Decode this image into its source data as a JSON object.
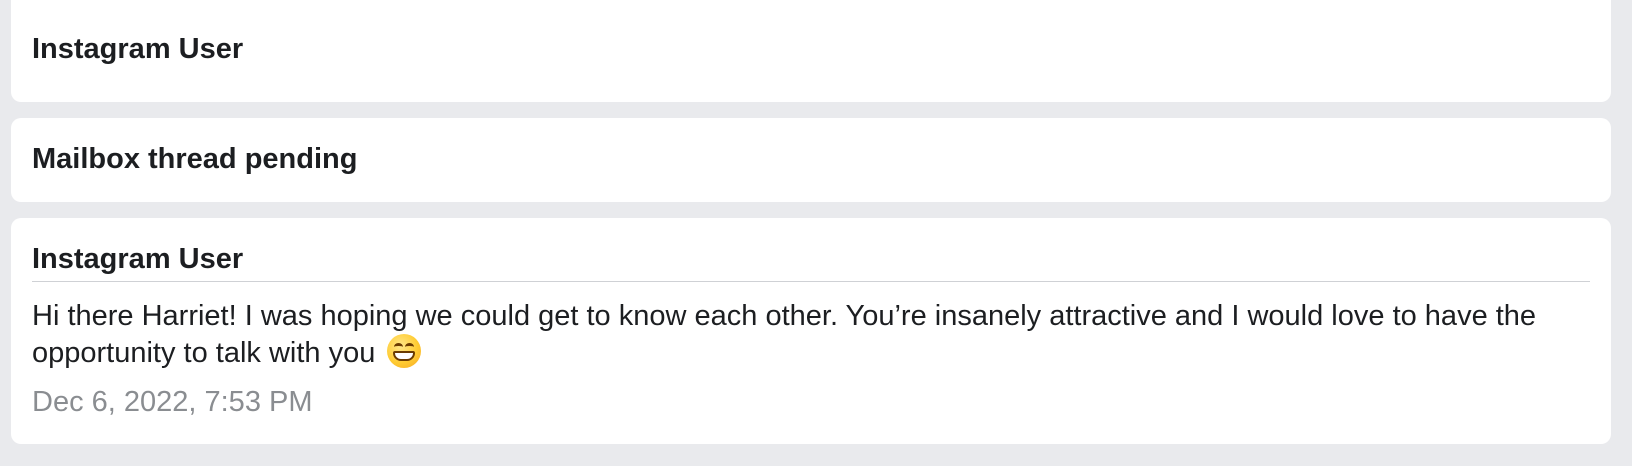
{
  "threads": {
    "first": {
      "title": "Instagram User"
    },
    "second": {
      "title": "Mailbox thread pending"
    },
    "third": {
      "title": "Instagram User",
      "message_text": "Hi there Harriet! I was hoping we could get to know each other. You’re insanely attractive and I would love to have the opportunity to talk with you",
      "emoji": "grinning-face-with-smiling-eyes",
      "timestamp": "Dec 6, 2022, 7:53 PM"
    }
  },
  "colors": {
    "page_background": "#e9eaed",
    "card_background": "#ffffff",
    "primary_text": "#1c1e21",
    "timestamp_text": "#8a8d91",
    "divider": "#cfd1d5"
  }
}
